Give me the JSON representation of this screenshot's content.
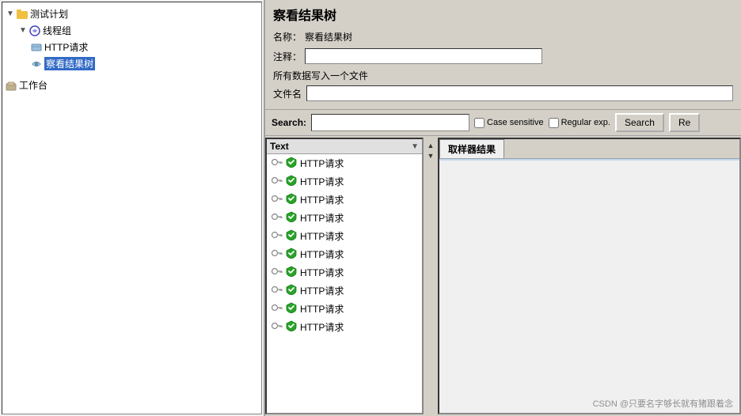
{
  "leftPanel": {
    "treeItems": [
      {
        "id": "test-plan",
        "label": "测试计划",
        "indent": 0,
        "type": "folder",
        "expanded": true
      },
      {
        "id": "thread-group",
        "label": "线程组",
        "indent": 1,
        "type": "thread",
        "expanded": true
      },
      {
        "id": "http-request",
        "label": "HTTP请求",
        "indent": 2,
        "type": "http"
      },
      {
        "id": "result-tree",
        "label": "察看结果树",
        "indent": 2,
        "type": "eye",
        "selected": true
      }
    ],
    "workbench": {
      "label": "工作台"
    }
  },
  "rightPanel": {
    "title": "察看结果树",
    "nameLabel": "名称：",
    "nameValue": "察看结果树",
    "commentLabel": "注释：",
    "commentValue": "",
    "sectionText": "所有数据写入一个文件",
    "fileLabel": "文件名",
    "fileValue": ""
  },
  "searchBar": {
    "label": "Search:",
    "placeholder": "",
    "caseSensitiveLabel": "Case sensitive",
    "regularExpLabel": "Regular exp.",
    "searchButtonLabel": "Search",
    "resetButtonLabel": "Re"
  },
  "listPanel": {
    "headerLabel": "Text",
    "items": [
      "HTTP请求",
      "HTTP请求",
      "HTTP请求",
      "HTTP请求",
      "HTTP请求",
      "HTTP请求",
      "HTTP请求",
      "HTTP请求",
      "HTTP请求",
      "HTTP请求"
    ]
  },
  "resultPanel": {
    "tabs": [
      {
        "label": "取样器结果",
        "active": true
      }
    ]
  },
  "watermark": "CSDN @只要名字够长就有猪跟着念"
}
